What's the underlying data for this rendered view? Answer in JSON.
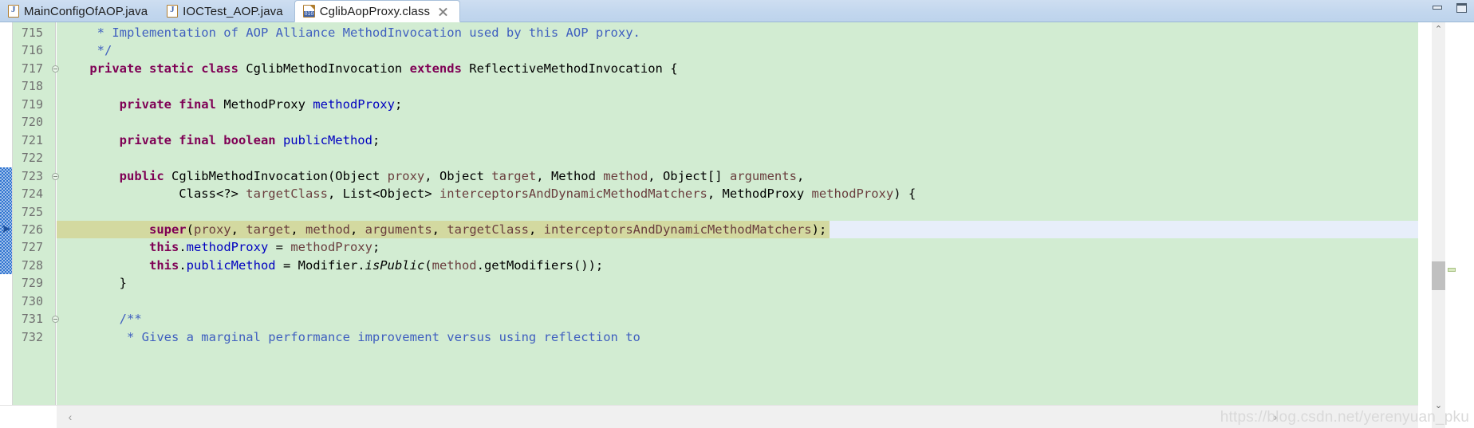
{
  "window": {
    "minimize_label": "Minimize",
    "maximize_label": "Maximize"
  },
  "tabs": [
    {
      "label": "MainConfigOfAOP.java",
      "icon": "java-file-icon",
      "active": false,
      "closable": false
    },
    {
      "label": "IOCTest_AOP.java",
      "icon": "java-file-icon",
      "active": false,
      "closable": false
    },
    {
      "label": "CglibAopProxy.class",
      "icon": "class-file-icon",
      "active": true,
      "closable": true
    }
  ],
  "editor": {
    "first_line": 715,
    "highlighted_line": 726,
    "fold_lines": [
      717,
      723,
      731
    ],
    "debug_scope_lines": [
      723,
      728
    ],
    "lines": [
      {
        "n": 715,
        "segments": [
          {
            "t": "cmt",
            "s": "     * Implementation of AOP Alliance MethodInvocation used by this AOP proxy."
          }
        ]
      },
      {
        "n": 716,
        "segments": [
          {
            "t": "cmt",
            "s": "     */"
          }
        ]
      },
      {
        "n": 717,
        "segments": [
          {
            "t": "kw",
            "s": "    private static class "
          },
          {
            "t": "plain",
            "s": "CglibMethodInvocation "
          },
          {
            "t": "kw",
            "s": "extends "
          },
          {
            "t": "plain",
            "s": "ReflectiveMethodInvocation {"
          }
        ]
      },
      {
        "n": 718,
        "segments": [
          {
            "t": "plain",
            "s": ""
          }
        ]
      },
      {
        "n": 719,
        "segments": [
          {
            "t": "kw",
            "s": "        private final "
          },
          {
            "t": "plain",
            "s": "MethodProxy "
          },
          {
            "t": "fld",
            "s": "methodProxy"
          },
          {
            "t": "plain",
            "s": ";"
          }
        ]
      },
      {
        "n": 720,
        "segments": [
          {
            "t": "plain",
            "s": ""
          }
        ]
      },
      {
        "n": 721,
        "segments": [
          {
            "t": "kw",
            "s": "        private final boolean "
          },
          {
            "t": "fld",
            "s": "publicMethod"
          },
          {
            "t": "plain",
            "s": ";"
          }
        ]
      },
      {
        "n": 722,
        "segments": [
          {
            "t": "plain",
            "s": ""
          }
        ]
      },
      {
        "n": 723,
        "segments": [
          {
            "t": "kw",
            "s": "        public "
          },
          {
            "t": "plain",
            "s": "CglibMethodInvocation(Object "
          },
          {
            "t": "par",
            "s": "proxy"
          },
          {
            "t": "plain",
            "s": ", Object "
          },
          {
            "t": "par",
            "s": "target"
          },
          {
            "t": "plain",
            "s": ", Method "
          },
          {
            "t": "par",
            "s": "method"
          },
          {
            "t": "plain",
            "s": ", Object[] "
          },
          {
            "t": "par",
            "s": "arguments"
          },
          {
            "t": "plain",
            "s": ","
          }
        ]
      },
      {
        "n": 724,
        "segments": [
          {
            "t": "plain",
            "s": "                Class<?> "
          },
          {
            "t": "par",
            "s": "targetClass"
          },
          {
            "t": "plain",
            "s": ", List<Object> "
          },
          {
            "t": "par",
            "s": "interceptorsAndDynamicMethodMatchers"
          },
          {
            "t": "plain",
            "s": ", MethodProxy "
          },
          {
            "t": "par",
            "s": "methodProxy"
          },
          {
            "t": "plain",
            "s": ") {"
          }
        ]
      },
      {
        "n": 725,
        "segments": [
          {
            "t": "plain",
            "s": ""
          }
        ]
      },
      {
        "n": 726,
        "segments": [
          {
            "t": "kw",
            "s": "            super"
          },
          {
            "t": "plain",
            "s": "("
          },
          {
            "t": "par",
            "s": "proxy"
          },
          {
            "t": "plain",
            "s": ", "
          },
          {
            "t": "par",
            "s": "target"
          },
          {
            "t": "plain",
            "s": ", "
          },
          {
            "t": "par",
            "s": "method"
          },
          {
            "t": "plain",
            "s": ", "
          },
          {
            "t": "par",
            "s": "arguments"
          },
          {
            "t": "plain",
            "s": ", "
          },
          {
            "t": "par",
            "s": "targetClass"
          },
          {
            "t": "plain",
            "s": ", "
          },
          {
            "t": "par",
            "s": "interceptorsAndDynamicMethodMatchers"
          },
          {
            "t": "plain",
            "s": ");"
          }
        ]
      },
      {
        "n": 727,
        "segments": [
          {
            "t": "kw",
            "s": "            this"
          },
          {
            "t": "plain",
            "s": "."
          },
          {
            "t": "fld",
            "s": "methodProxy"
          },
          {
            "t": "plain",
            "s": " = "
          },
          {
            "t": "par",
            "s": "methodProxy"
          },
          {
            "t": "plain",
            "s": ";"
          }
        ]
      },
      {
        "n": 728,
        "segments": [
          {
            "t": "kw",
            "s": "            this"
          },
          {
            "t": "plain",
            "s": "."
          },
          {
            "t": "fld",
            "s": "publicMethod"
          },
          {
            "t": "plain",
            "s": " = Modifier."
          },
          {
            "t": "stat",
            "s": "isPublic"
          },
          {
            "t": "plain",
            "s": "("
          },
          {
            "t": "par",
            "s": "method"
          },
          {
            "t": "plain",
            "s": ".getModifiers());"
          }
        ]
      },
      {
        "n": 729,
        "segments": [
          {
            "t": "plain",
            "s": "        }"
          }
        ]
      },
      {
        "n": 730,
        "segments": [
          {
            "t": "plain",
            "s": ""
          }
        ]
      },
      {
        "n": 731,
        "segments": [
          {
            "t": "cmt",
            "s": "        /**"
          }
        ]
      },
      {
        "n": 732,
        "segments": [
          {
            "t": "cmt",
            "s": "         * Gives a marginal performance improvement versus using reflection to"
          }
        ]
      }
    ]
  },
  "scrollbars": {
    "vertical_up_glyph": "⌃",
    "vertical_down_glyph": "⌄",
    "horizontal_left_glyph": "‹",
    "horizontal_right_glyph": "›"
  },
  "watermark": {
    "text": "https://blog.csdn.net/yerenyuan_pku"
  },
  "colors": {
    "editor_background": "#d2ecd2",
    "gutter_background": "#d2ecd2",
    "highlight_line": "#d3d9a0",
    "selection": "#e7eefa",
    "tabbar": "#c3d7ee",
    "comment": "#3f5fbf",
    "keyword": "#7f0055",
    "field": "#0000c0",
    "parameter": "#6a3e3e",
    "debug_marker": "#2f74d0"
  }
}
